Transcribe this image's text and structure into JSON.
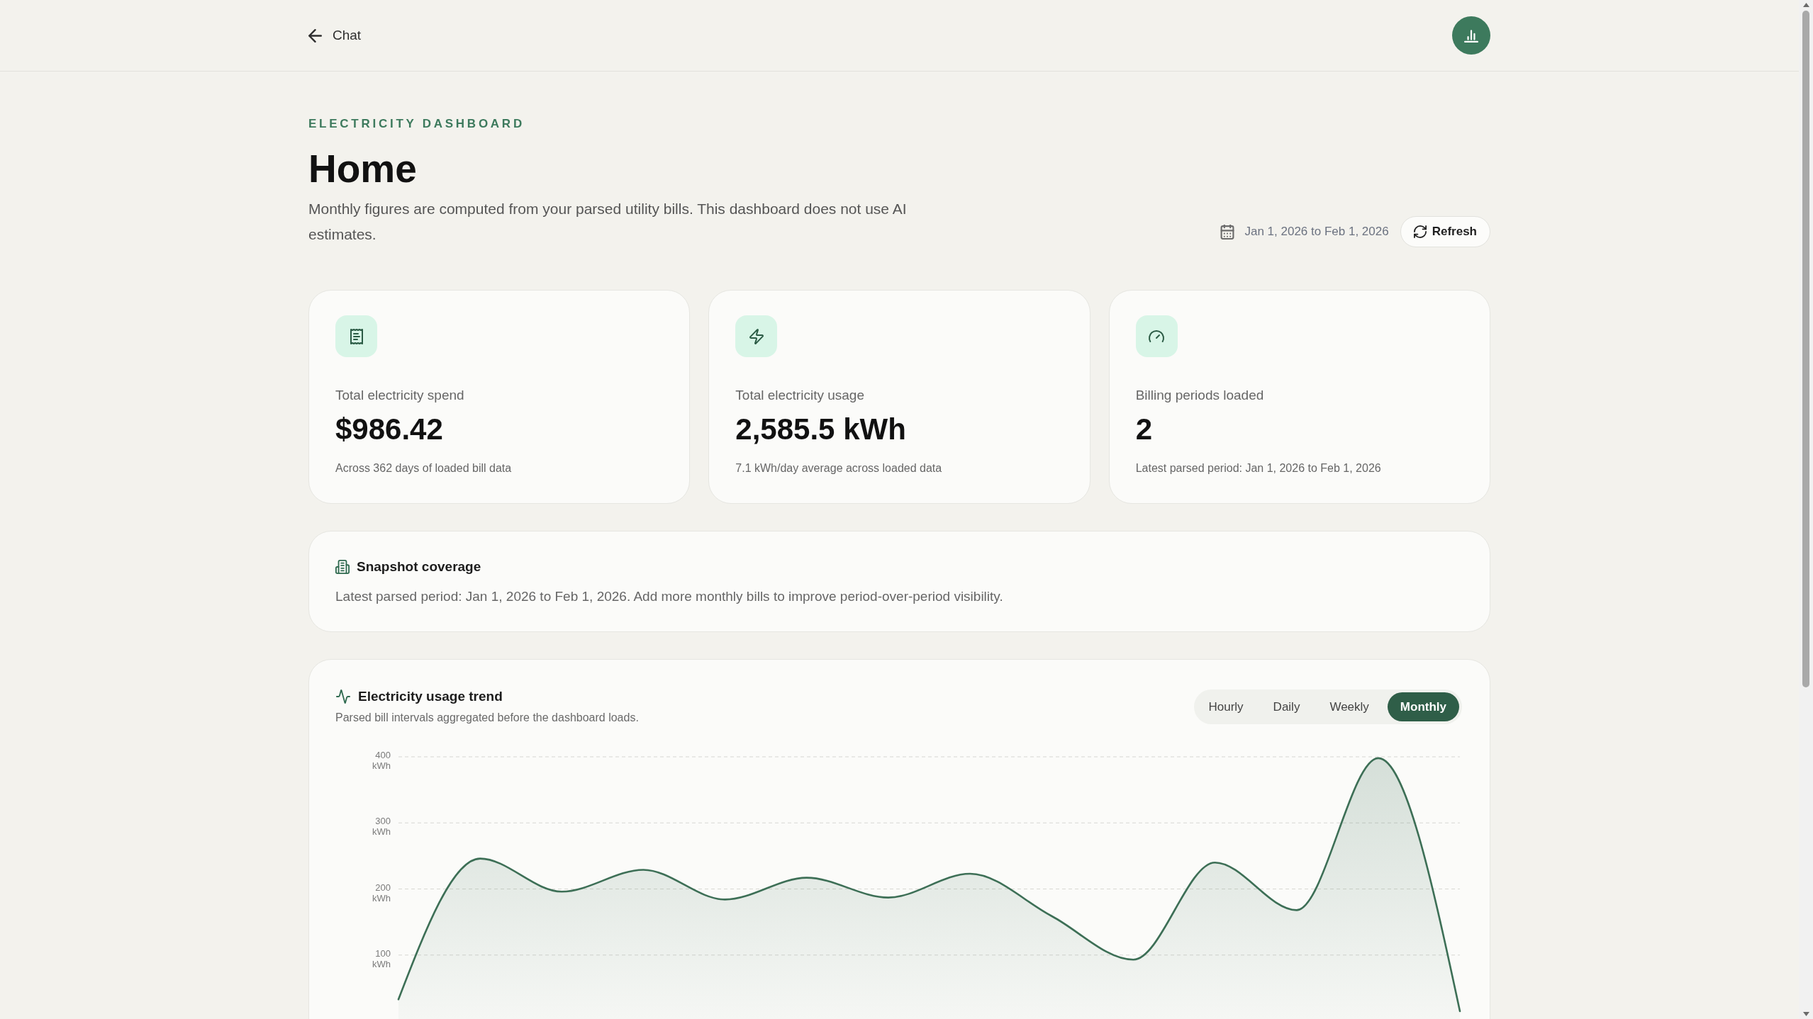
{
  "top_bar": {
    "back_link": "Chat"
  },
  "header": {
    "eyebrow": "ELECTRICITY DASHBOARD",
    "title": "Home",
    "description": "Monthly figures are computed from your parsed utility bills. This dashboard does not use AI estimates.",
    "date_range": "Jan 1, 2026 to Feb 1, 2026",
    "refresh_button": "Refresh"
  },
  "stat_cards": [
    {
      "label": "Total electricity spend",
      "value": "$986.42",
      "note": "Across 362 days of loaded bill data"
    },
    {
      "label": "Total electricity usage",
      "value": "2,585.5 kWh",
      "note": "7.1 kWh/day average across loaded data"
    },
    {
      "label": "Billing periods loaded",
      "value": "2",
      "note": "Latest parsed period: Jan 1, 2026 to Feb 1, 2026"
    }
  ],
  "snapshot_coverage": {
    "title": "Snapshot coverage",
    "text": "Latest parsed period: Jan 1, 2026 to Feb 1, 2026. Add more monthly bills to improve period-over-period visibility."
  },
  "usage_trend": {
    "title": "Electricity usage trend",
    "subtitle": "Parsed bill intervals aggregated before the dashboard loads.",
    "tabs": [
      {
        "label": "Hourly",
        "selected": false
      },
      {
        "label": "Daily",
        "selected": false
      },
      {
        "label": "Weekly",
        "selected": false
      },
      {
        "label": "Monthly",
        "selected": true
      }
    ],
    "chart_data": {
      "type": "area",
      "values": [
        33,
        246,
        196,
        229,
        184,
        217,
        187,
        223,
        159,
        93,
        240,
        168,
        398,
        15
      ],
      "ylim": [
        0,
        400
      ],
      "yticks": [
        {
          "value": 100,
          "label": "100 kWh"
        },
        {
          "value": 200,
          "label": "200 kWh"
        },
        {
          "value": 300,
          "label": "300 kWh"
        },
        {
          "value": 400,
          "label": "400 kWh"
        }
      ],
      "grid": true
    }
  }
}
